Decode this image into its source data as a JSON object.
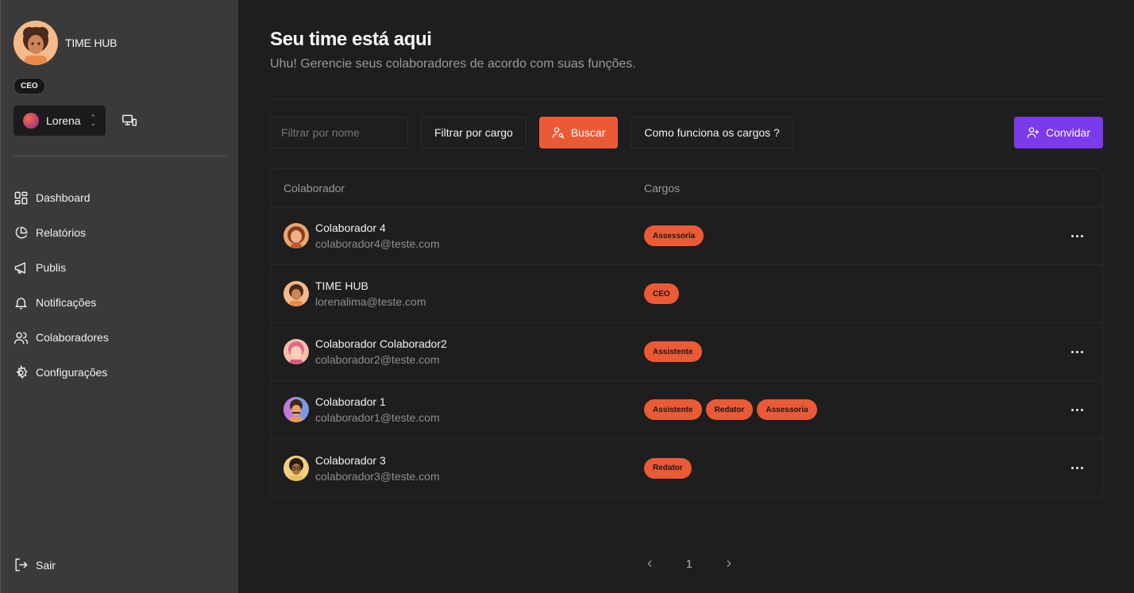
{
  "profile": {
    "name": "TIME HUB",
    "role": "CEO"
  },
  "workspace": {
    "name": "Lorena"
  },
  "nav": [
    {
      "label": "Dashboard",
      "icon": "dashboard-icon"
    },
    {
      "label": "Relatórios",
      "icon": "pie-chart-icon"
    },
    {
      "label": "Publis",
      "icon": "megaphone-icon"
    },
    {
      "label": "Notificações",
      "icon": "bell-icon"
    },
    {
      "label": "Colaboradores",
      "icon": "users-icon"
    },
    {
      "label": "Configurações",
      "icon": "gear-icon"
    }
  ],
  "logout": {
    "label": "Sair"
  },
  "page": {
    "title": "Seu time está aqui",
    "subtitle": "Uhu! Gerencie seus colaboradores de acordo com suas funções."
  },
  "toolbar": {
    "filter_name_placeholder": "Filtrar por nome",
    "filter_role_label": "Filtrar por cargo",
    "search_label": "Buscar",
    "how_roles_label": "Como funciona os cargos ?",
    "invite_label": "Convidar"
  },
  "table": {
    "headers": {
      "user": "Colaborador",
      "roles": "Cargos"
    },
    "rows": [
      {
        "name": "Colaborador 4",
        "email": "colaborador4@teste.com",
        "roles": [
          "Assessoria"
        ],
        "actions": true
      },
      {
        "name": "TIME HUB",
        "email": "lorenalima@teste.com",
        "roles": [
          "CEO"
        ],
        "actions": false
      },
      {
        "name": "Colaborador Colaborador2",
        "email": "colaborador2@teste.com",
        "roles": [
          "Assistente"
        ],
        "actions": true
      },
      {
        "name": "Colaborador 1",
        "email": "colaborador1@teste.com",
        "roles": [
          "Assistente",
          "Redator",
          "Assessoria"
        ],
        "actions": true
      },
      {
        "name": "Colaborador 3",
        "email": "colaborador3@teste.com",
        "roles": [
          "Redator"
        ],
        "actions": true
      }
    ]
  },
  "pagination": {
    "current": "1"
  },
  "colors": {
    "accent_orange": "#ec5a35",
    "accent_purple": "#7c3aed",
    "sidebar_bg": "#3a3a3a",
    "main_bg": "#1e1e1e"
  }
}
